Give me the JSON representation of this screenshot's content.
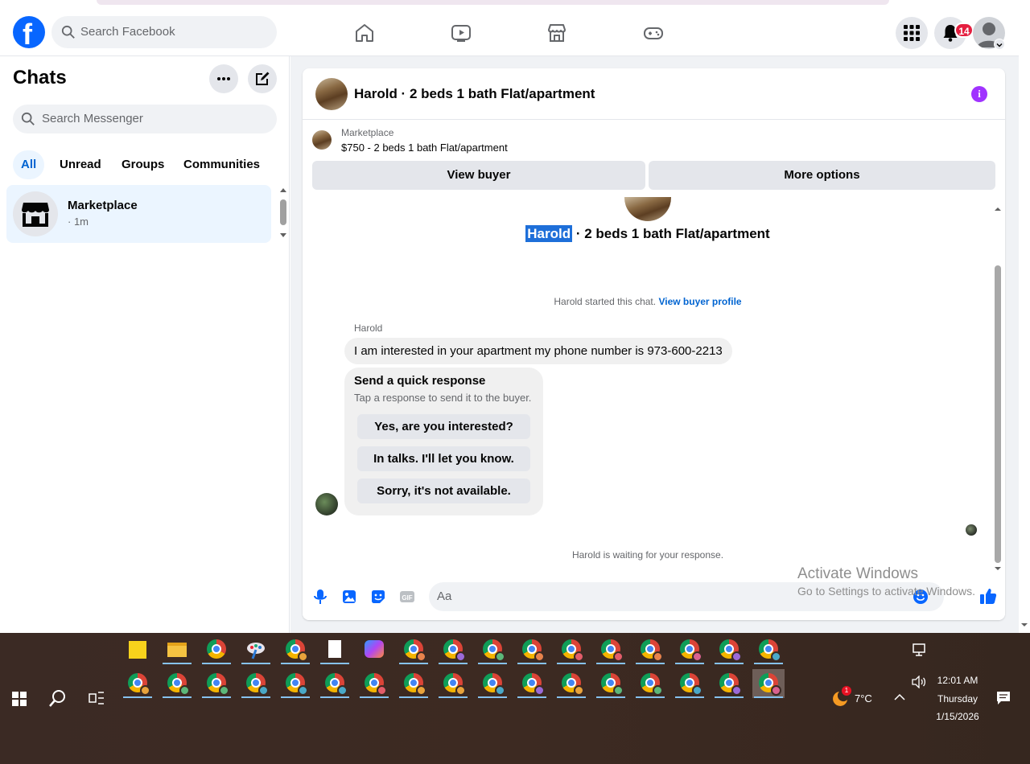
{
  "header": {
    "search_placeholder": "Search Facebook",
    "notification_count": "14"
  },
  "sidebar": {
    "title": "Chats",
    "search_placeholder": "Search Messenger",
    "filters": [
      "All",
      "Unread",
      "Groups",
      "Communities"
    ],
    "active_filter": "All",
    "chats": [
      {
        "name": "Marketplace",
        "time": "· 1m"
      }
    ]
  },
  "conversation": {
    "title": "Harold · 2 beds 1 bath Flat/apartment",
    "marketplace_label": "Marketplace",
    "listing": "$750 - 2 beds 1 bath Flat/apartment",
    "view_buyer": "View buyer",
    "more_options": "More options",
    "hero_name": "Harold",
    "hero_rest": " · 2 beds 1 bath Flat/apartment",
    "started_note": "Harold started this chat.",
    "view_buyer_profile": "View buyer profile",
    "sender_name": "Harold",
    "message": "I am interested in your apartment my phone number is 973-600-2213",
    "quick_title": "Send a quick response",
    "quick_subtitle": "Tap a response to send it to the buyer.",
    "quick_responses": [
      "Yes, are you interested?",
      "In talks. I'll let you know.",
      "Sorry, it's not available."
    ],
    "waiting_note": "Harold is waiting for your response.",
    "composer_placeholder": "Aa"
  },
  "watermark": {
    "line1": "Activate Windows",
    "line2": "Go to Settings to activate Windows."
  },
  "taskbar": {
    "temperature": "7°C",
    "weather_badge": "1",
    "time": "12:01 AM",
    "day": "Thursday",
    "date": "1/15/2026"
  },
  "colors": {
    "brand": "#0866ff",
    "accent_link": "#0064d1",
    "info": "#a033ff",
    "notification": "#e41e3f"
  }
}
